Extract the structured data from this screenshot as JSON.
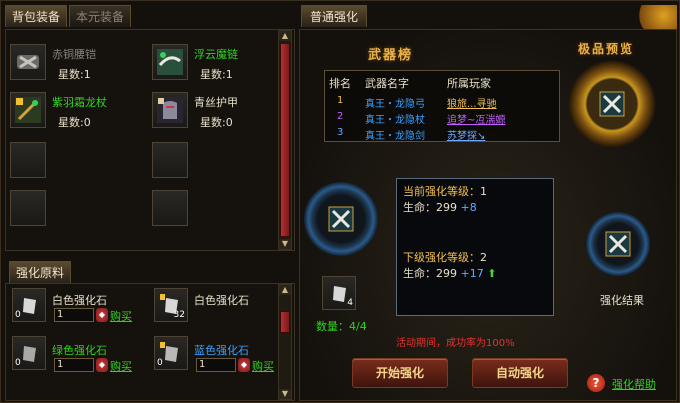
{
  "tabs": {
    "bag": "背包装备",
    "native": "本元装备",
    "materials": "强化原料",
    "normal": "普通强化"
  },
  "bag_items": [
    {
      "name": "赤铜腰铠",
      "stars": "星数:1",
      "color": "#8a8478"
    },
    {
      "name": "浮云魔链",
      "stars": "星数:1",
      "color": "#2fd31f"
    },
    {
      "name": "紫羽霜龙杖",
      "stars": "星数:0",
      "color": "#2fd31f"
    },
    {
      "name": "青丝护甲",
      "stars": "星数:0",
      "color": "#e8e0c8"
    }
  ],
  "materials": [
    {
      "name": "白色强化石",
      "count": "0",
      "qty": "1",
      "buy": "购买",
      "color": "#e8e0c8"
    },
    {
      "name": "白色强化石",
      "count": "32",
      "qty": "",
      "buy": "",
      "color": "#e8e0c8"
    },
    {
      "name": "绿色强化石",
      "count": "0",
      "qty": "1",
      "buy": "购买",
      "color": "#2fd31f"
    },
    {
      "name": "蓝色强化石",
      "count": "0",
      "qty": "1",
      "buy": "购买",
      "color": "#3aa0ff"
    }
  ],
  "ranking": {
    "title": "武器榜",
    "headers": [
      "排名",
      "武器名字",
      "所属玩家"
    ],
    "rows": [
      {
        "rank": "1",
        "weapon": "真王・龙隐弓",
        "player": "狼旅...寻驰",
        "rank_color": "#f0c050",
        "player_color": "#f0c050"
      },
      {
        "rank": "2",
        "weapon": "真王・龙隐杖",
        "player": "追梦~冱湍嫄",
        "rank_color": "#c060ff",
        "player_color": "#c060ff"
      },
      {
        "rank": "3",
        "weapon": "真王・龙隐剑",
        "player": "苏梦探↘",
        "rank_color": "#6aa8ff",
        "player_color": "#6aa8ff"
      }
    ]
  },
  "preview": {
    "title": "极品预览"
  },
  "enhance": {
    "current_label": "当前强化等级：",
    "current_level": "1",
    "hp_label": "生命：",
    "current_hp": "299",
    "current_bonus": "+8",
    "next_label": "下级强化等级：",
    "next_level": "2",
    "next_hp": "299",
    "next_bonus": "+17",
    "up_arrow": "⬆"
  },
  "material_count": "4",
  "quantity_text": "数量：4/4",
  "result_label": "强化结果",
  "notice": "活动期间，成功率为100%",
  "buttons": {
    "start": "开始强化",
    "auto": "自动强化"
  },
  "help": {
    "icon": "?",
    "link": "强化帮助"
  }
}
